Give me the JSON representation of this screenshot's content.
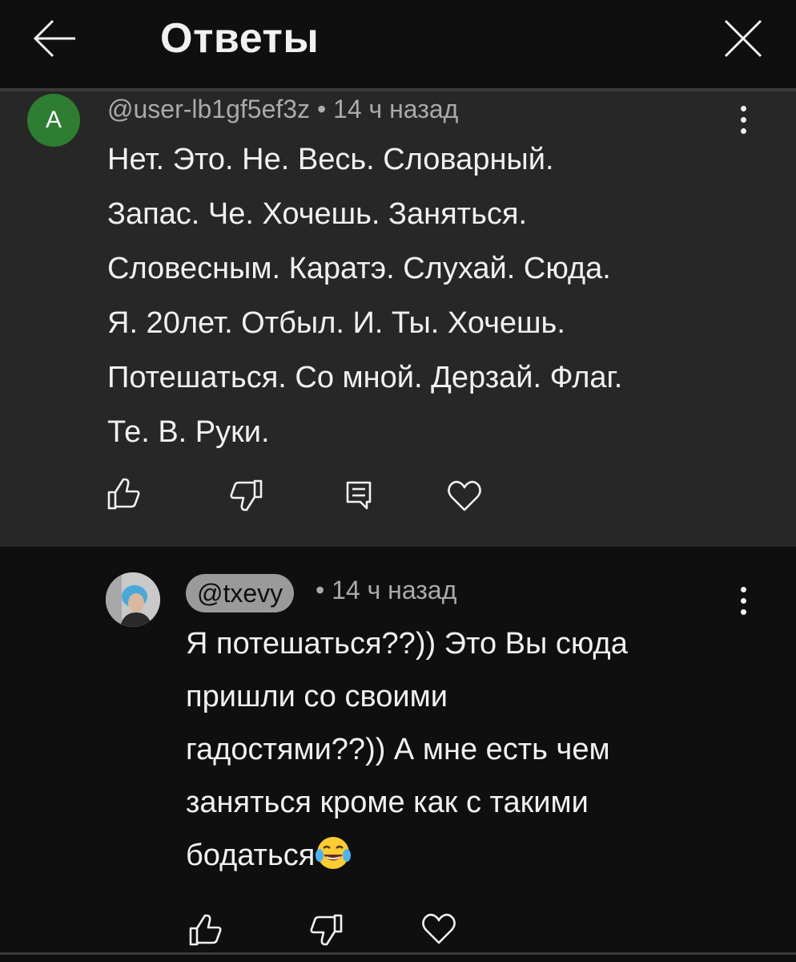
{
  "header": {
    "title": "Ответы"
  },
  "parent_comment": {
    "avatar_letter": "A",
    "author": "@user-lb1gf5ef3z",
    "separator": " • ",
    "time": "14 ч назад",
    "lines": [
      "Нет. Это. Не. Весь. Словарный.",
      "Запас. Че. Хочешь. Заняться.",
      "Словесным. Каратэ. Слухай. Сюда.",
      "Я. 20лет. Отбыл. И. Ты. Хочешь.",
      "Потешаться. Со мной. Дерзай. Флаг.",
      "Те. В. Руки."
    ]
  },
  "reply_comment": {
    "author": "@txevy",
    "separator": "• ",
    "time": "14 ч назад",
    "lines": [
      "Я потешаться??)) Это Вы сюда",
      "пришли со своими",
      "гадостями??)) А мне есть чем",
      "заняться кроме как с такими",
      "бодаться"
    ],
    "trailing_emoji": "face-with-tears-of-joy"
  },
  "icons": {
    "back": "arrow-left-icon",
    "close": "close-icon",
    "more": "kebab-menu-icon",
    "like": "thumbs-up-icon",
    "dislike": "thumbs-down-icon",
    "reply": "reply-icon",
    "heart": "heart-icon"
  },
  "colors": {
    "background": "#0f0f0f",
    "parent_background": "#272727",
    "avatar_a": "#2e7d32",
    "text": "#f1f1f1",
    "meta_text": "#aaaaaa",
    "handle_chip": "#9a9a9a"
  }
}
